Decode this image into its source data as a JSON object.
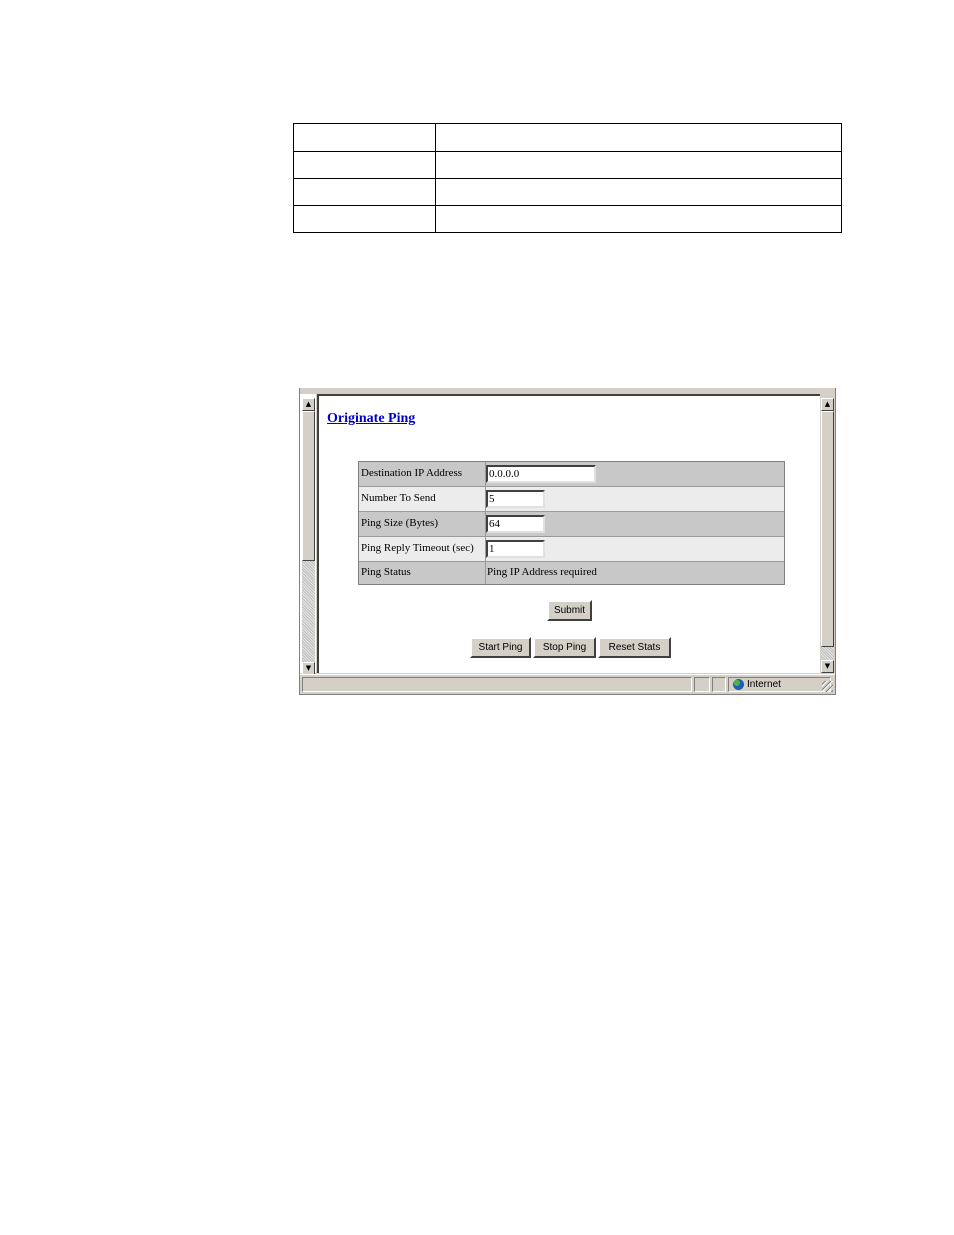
{
  "window": {
    "page_title": "Originate Ping",
    "status_zone": "Internet",
    "scroll_up_glyph": "▲",
    "scroll_down_glyph": "▼"
  },
  "ping_form": {
    "rows": [
      {
        "label": "Destination IP Address",
        "value": "0.0.0.0"
      },
      {
        "label": "Number To Send",
        "value": "5"
      },
      {
        "label": "Ping Size (Bytes)",
        "value": "64"
      },
      {
        "label": "Ping Reply Timeout (sec)",
        "value": "1"
      },
      {
        "label": "Ping Status",
        "value": "Ping IP Address required"
      }
    ],
    "submit_label": "Submit",
    "start_label": "Start Ping",
    "stop_label": "Stop Ping",
    "reset_label": "Reset Stats"
  },
  "icons": {
    "status": "globe-icon",
    "resize": "resize-grip-icon"
  }
}
